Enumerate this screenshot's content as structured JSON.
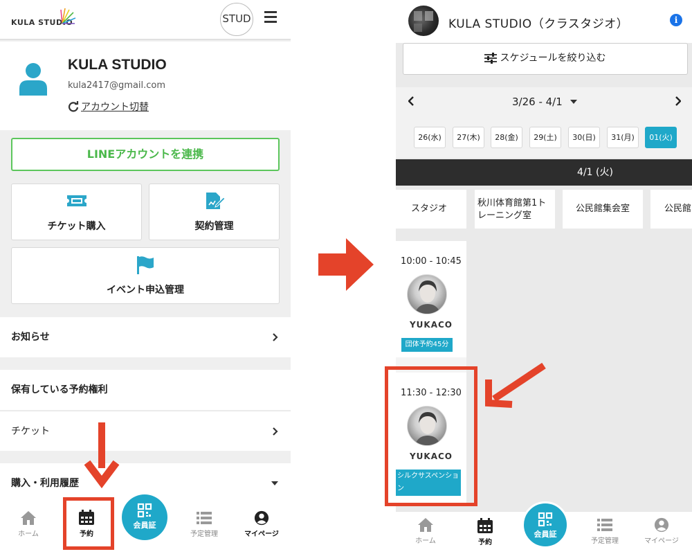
{
  "left_screen": {
    "logo_text": "KULA STUDIO",
    "studio_badge": "STUD",
    "profile": {
      "name": "KULA STUDIO",
      "email": "kula2417@gmail.com",
      "switch_account": "アカウント切替"
    },
    "line_button": "LINEアカウントを連携",
    "cards": {
      "ticket": "チケット購入",
      "contract": "契約管理",
      "event": "イベント申込管理"
    },
    "rows": {
      "news": "お知らせ",
      "rights": "保有している予約権利",
      "ticket": "チケット",
      "history": "購入・利用履歴"
    },
    "nav": {
      "home": "ホーム",
      "booking": "予約",
      "member_card": "会員証",
      "schedule": "予定管理",
      "mypage": "マイページ"
    }
  },
  "right_screen": {
    "title": "KULA STUDIO（クラスタジオ）",
    "info_icon": "i",
    "filter_button": "スケジュールを絞り込む",
    "date_range": "3/26 - 4/1",
    "days": [
      "26(水)",
      "27(木)",
      "28(金)",
      "29(土)",
      "30(日)",
      "31(月)",
      "01(火)"
    ],
    "active_day_index": 6,
    "selected_date": "4/1 (火)",
    "studios": [
      "スタジオ",
      "秋川体育館第1トレーニング室",
      "公民館集会室",
      "公民館"
    ],
    "slots": [
      {
        "time": "10:00 - 10:45",
        "instructor": "YUKACO",
        "tag": "団体予約45分"
      },
      {
        "time": "11:30 - 12:30",
        "instructor": "YUKACO",
        "tag": "シルクサスペンション"
      }
    ],
    "nav": {
      "home": "ホーム",
      "booking": "予約",
      "member_card": "会員証",
      "schedule": "予定管理",
      "mypage": "マイページ"
    }
  },
  "colors": {
    "accent_teal": "#1fa8c9",
    "line_green": "#4bb84b",
    "highlight_red": "#e4432a",
    "dark_bar": "#2d2d2d"
  }
}
